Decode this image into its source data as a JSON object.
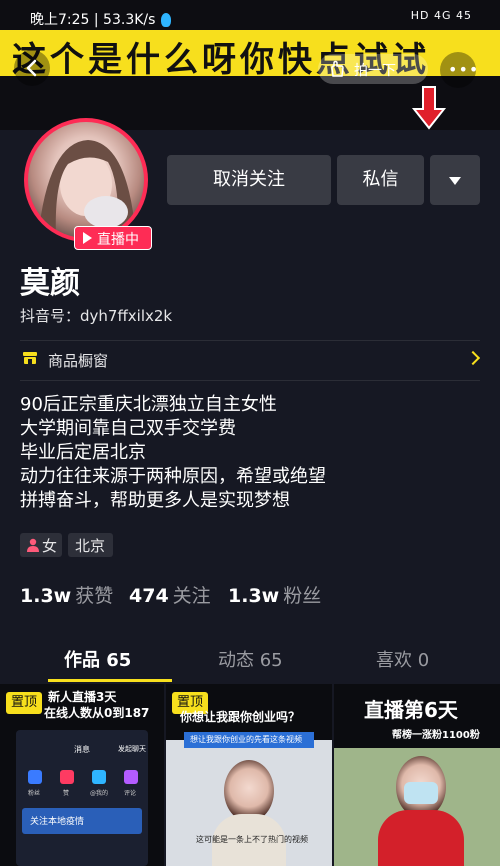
{
  "status_bar": {
    "left": "晚上7:25 | 53.3K/s",
    "right": "HD 4G 45"
  },
  "cover": {
    "banner_text": "这个是什么呀你快点试试",
    "pat_label": "拍一下"
  },
  "profile": {
    "live_label": "直播中",
    "nickname": "莫颜",
    "douyin_id": "抖音号：dyh7ffxilx2k"
  },
  "actions": {
    "unfollow_label": "取消关注",
    "message_label": "私信"
  },
  "shop": {
    "label": "商品橱窗"
  },
  "bio": {
    "lines": [
      "90后正宗重庆北漂独立自主女性",
      "大学期间靠自己双手交学费",
      "毕业后定居北京",
      "动力往往来源于两种原因，希望或绝望",
      "拼搏奋斗，帮助更多人是实现梦想"
    ]
  },
  "tags": {
    "gender": "女",
    "city": "北京"
  },
  "stats": [
    {
      "number": "1.3w",
      "label": "获赞"
    },
    {
      "number": "474",
      "label": "关注"
    },
    {
      "number": "1.3w",
      "label": "粉丝"
    }
  ],
  "tabs": [
    {
      "label": "作品 65",
      "active": true
    },
    {
      "label": "动态 65",
      "active": false
    },
    {
      "label": "喜欢 0",
      "active": false
    }
  ],
  "videos": [
    {
      "pinned_label": "置顶",
      "caption_lines": [
        "新人直播3天",
        "在线人数从0到187"
      ],
      "screen_title": "消息",
      "screen_button": "发起聊天",
      "screen_icons": [
        "粉丝",
        "赞",
        "@我的",
        "评论"
      ],
      "screen_banner": "关注本地疫情"
    },
    {
      "pinned_label": "置顶",
      "caption_lines": [
        "你想让我跟你创业吗？"
      ],
      "banner": "想让我跟你创业的先看这条视频",
      "subtitle": "这可能是一条上不了热门的视频"
    },
    {
      "caption_lines": [
        "直播第6天"
      ],
      "subtitle": "帮榜一涨粉1100粉"
    }
  ],
  "colors": {
    "background": "#161823",
    "accent_yellow": "#f7df1d",
    "live_red": "#fe2c55",
    "button_gray": "#393b44"
  }
}
